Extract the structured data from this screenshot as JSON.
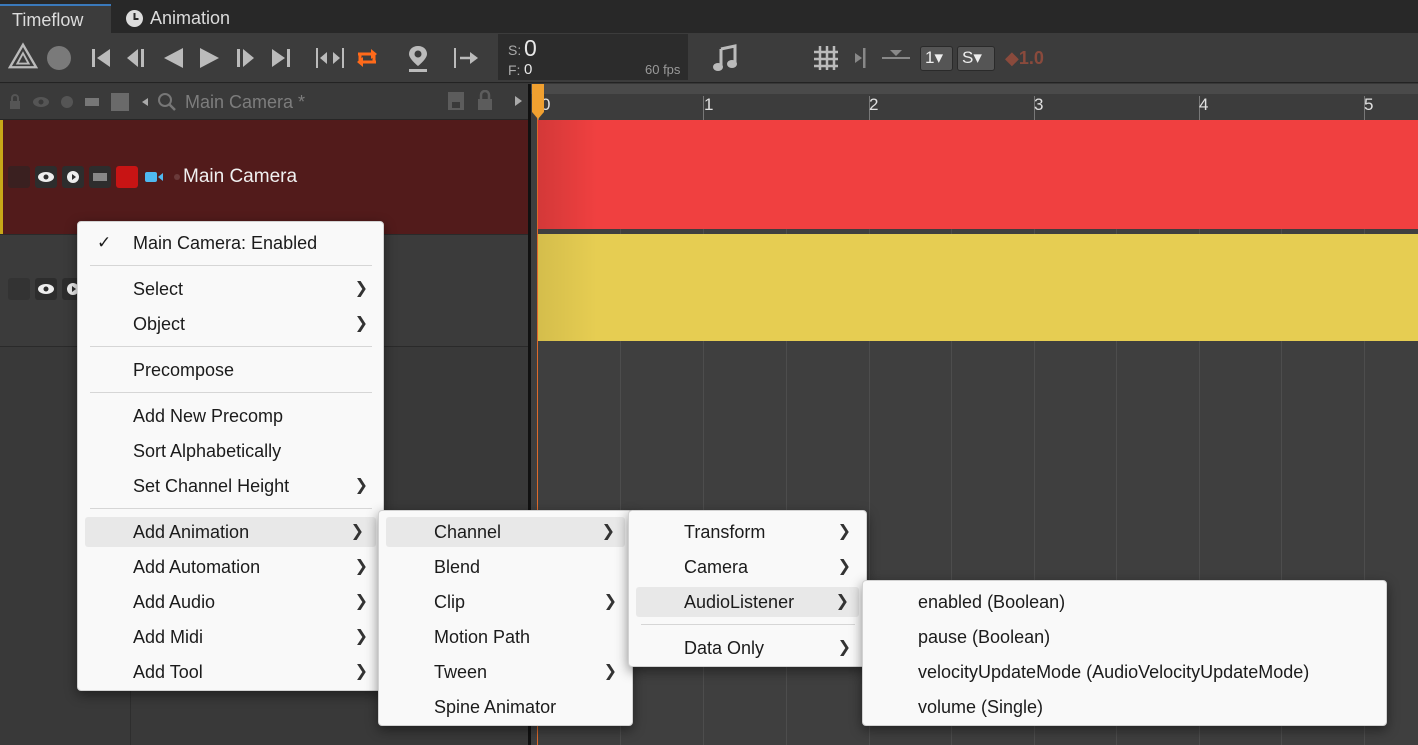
{
  "tabs": [
    {
      "label": "Timeflow",
      "icon": "timeflow-tab"
    },
    {
      "label": "Animation",
      "icon": "clock-icon"
    }
  ],
  "time": {
    "s_label": "S:",
    "s_value": "0",
    "f_label": "F:",
    "f_value": "0",
    "fps": "60 fps"
  },
  "toolbar": {
    "snap1": "1▾",
    "snap2": "S▾",
    "speed": "◆1.0"
  },
  "header": {
    "object_name": "Main Camera *"
  },
  "ruler": {
    "labels": [
      "0",
      "1",
      "2",
      "3",
      "4",
      "5"
    ]
  },
  "tracks": [
    {
      "name": "Main Camera",
      "color": "#f04040"
    },
    {
      "name": "",
      "color": "#e6cd52"
    }
  ],
  "menu1": {
    "items": [
      {
        "label": "Main Camera: Enabled",
        "checked": true
      },
      {
        "label": "Select",
        "submenu": true
      },
      {
        "label": "Object",
        "submenu": true
      },
      {
        "label": "Precompose"
      },
      {
        "label": "Add New Precomp"
      },
      {
        "label": "Sort Alphabetically"
      },
      {
        "label": "Set Channel Height",
        "submenu": true
      },
      {
        "label": "Add Animation",
        "submenu": true
      },
      {
        "label": "Add Automation",
        "submenu": true
      },
      {
        "label": "Add Audio",
        "submenu": true
      },
      {
        "label": "Add Midi",
        "submenu": true
      },
      {
        "label": "Add Tool",
        "submenu": true
      }
    ]
  },
  "menu2": {
    "items": [
      {
        "label": "Channel",
        "submenu": true
      },
      {
        "label": "Blend"
      },
      {
        "label": "Clip",
        "submenu": true
      },
      {
        "label": "Motion Path"
      },
      {
        "label": "Tween",
        "submenu": true
      },
      {
        "label": "Spine Animator"
      }
    ]
  },
  "menu3": {
    "items": [
      {
        "label": "Transform",
        "submenu": true
      },
      {
        "label": "Camera",
        "submenu": true
      },
      {
        "label": "AudioListener",
        "submenu": true
      },
      {
        "label": "Data Only",
        "submenu": true
      }
    ]
  },
  "menu4": {
    "items": [
      {
        "label": "enabled (Boolean)"
      },
      {
        "label": "pause (Boolean)"
      },
      {
        "label": "velocityUpdateMode (AudioVelocityUpdateMode)"
      },
      {
        "label": "volume (Single)"
      }
    ]
  },
  "colors": {
    "accent": "#3a79bb",
    "loop": "#ff6a1a",
    "playhead": "#f0a030",
    "menu_bg": "#f9f9f9"
  }
}
